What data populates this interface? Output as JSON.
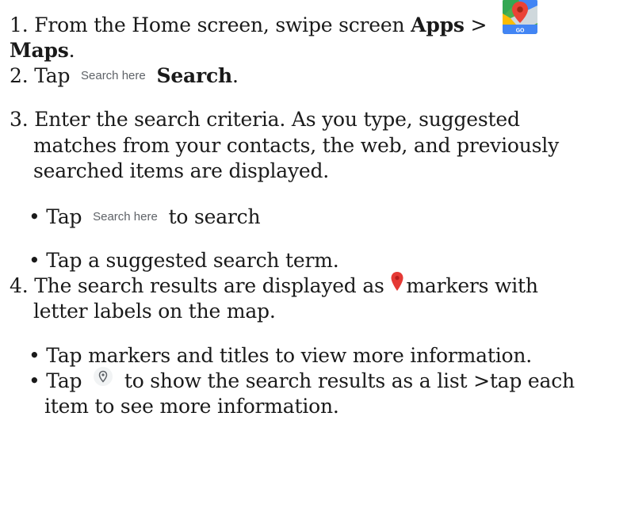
{
  "step1": {
    "prefix": "1. From the Home screen, swipe screen ",
    "apps": "Apps",
    "sep": " >",
    "maps": "Maps",
    "period": ".",
    "maps_icon": "google-maps-app-icon",
    "maps_icon_text": "GO"
  },
  "step2": {
    "prefix": "2. Tap",
    "search_hint": "Search here",
    "search_label": "Search",
    "period": "."
  },
  "step3": {
    "line1": "3. Enter the search criteria. As you type, suggested",
    "line2": "matches from your contacts, the web, and previously",
    "line3": "searched items are displayed.",
    "bullet1_prefix": "• Tap",
    "bullet1_hint": "Search here",
    "bullet1_suffix": "to search",
    "bullet2": "• Tap a suggested search term."
  },
  "step4": {
    "line1_prefix": "4. The search results are displayed as ",
    "marker_icon": "red-map-pin-icon",
    "line1_suffix": "markers with",
    "line2": "letter labels on the map.",
    "bullet1": "• Tap markers and titles to view more information.",
    "bullet2_prefix": "• Tap",
    "list_icon": "location-pin-circle-icon",
    "bullet2_suffix": "to show the search results as a list >tap each",
    "bullet2_line2": "item to see more information."
  },
  "colors": {
    "text": "#1a1a1a",
    "hint": "#5f6368",
    "marker_red": "#e53935"
  }
}
